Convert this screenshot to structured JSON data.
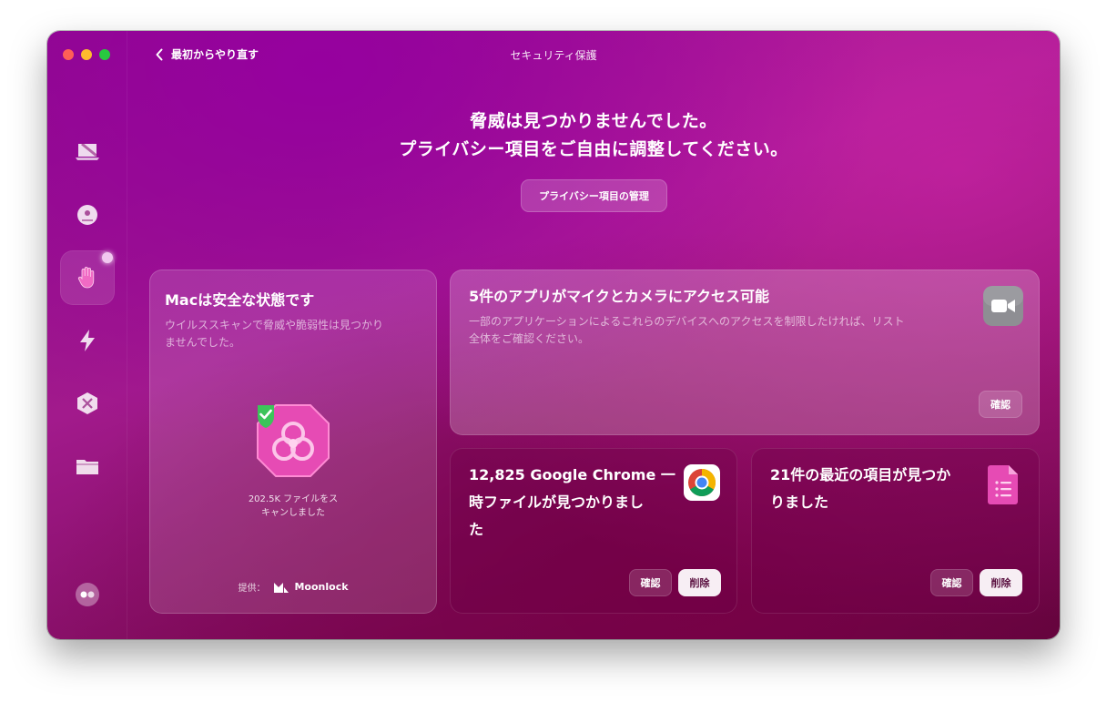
{
  "window": {
    "title": "セキュリティ保護",
    "back_label": "最初からやり直す"
  },
  "sidebar": {
    "items": [
      {
        "name": "smart-care",
        "icon": "laptop-icon"
      },
      {
        "name": "cleanup",
        "icon": "disc-icon"
      },
      {
        "name": "protection",
        "icon": "hand-icon",
        "active": true
      },
      {
        "name": "performance",
        "icon": "bolt-icon"
      },
      {
        "name": "applications",
        "icon": "apps-icon"
      },
      {
        "name": "my-clutter",
        "icon": "folder-icon"
      },
      {
        "name": "assistant",
        "icon": "assistant-icon"
      }
    ]
  },
  "hero": {
    "line1": "脅威は見つかりませんでした。",
    "line2": "プライバシー項目をご自由に調整してください。",
    "manage_button": "プライバシー項目の管理"
  },
  "cards": {
    "safe": {
      "title": "Macは安全な状態です",
      "desc_line1": "ウイルススキャンで脅威や脆弱性は見つかり",
      "desc_line2": "ませんでした。",
      "scan_line1": "202.5K ファイルをス",
      "scan_line2": "キャンしました",
      "provided_by": "提供：",
      "provider": "Moonlock"
    },
    "camera": {
      "title": "5件のアプリがマイクとカメラにアクセス可能",
      "desc_line1": "一部のアプリケーションによるこれらのデバイスへのアクセスを制限したければ、リスト",
      "desc_line2": "全体をご確認ください。",
      "review": "確認"
    },
    "chrome": {
      "title_line1": "12,825 Google Chrome 一",
      "title_line2": "時ファイルが見つかりまし",
      "title_line3": "た",
      "review": "確認",
      "remove": "削除"
    },
    "recent": {
      "title_line1": "21件の最近の項目が見つか",
      "title_line2": "りました",
      "review": "確認",
      "remove": "削除"
    }
  },
  "colors": {
    "accent_pink": "#e64bb4",
    "check_green": "#3cc35a"
  }
}
